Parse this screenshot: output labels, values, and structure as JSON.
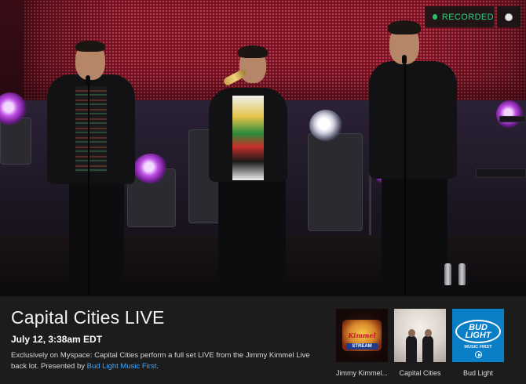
{
  "player": {
    "status_label": "RECORDED",
    "colors": {
      "status_dot": "#27c26b",
      "status_text": "#2fd07a"
    }
  },
  "info": {
    "title": "Capital Cities LIVE",
    "date": "July 12, 3:38am EDT",
    "description_text": "Exclusively on Myspace: Capital Cities perform a full set LIVE from the Jimmy Kimmel Live back lot. Presented by ",
    "description_link": "Bud Light Music First",
    "description_end": ".",
    "link_color": "#3ea6ff"
  },
  "related": [
    {
      "caption": "Jimmy Kimmel...",
      "logo_text": "Kimmel",
      "badge_text": "STREAM"
    },
    {
      "caption": "Capital Cities"
    },
    {
      "caption": "Bud Light",
      "logo_line1": "BUD",
      "logo_line2": "LIGHT",
      "logo_sub": "MUSIC FIRST"
    }
  ]
}
